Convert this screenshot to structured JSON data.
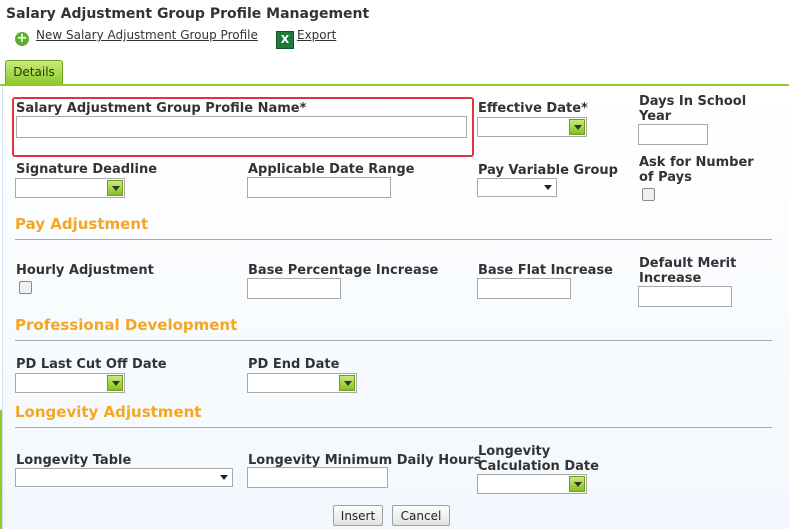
{
  "header": {
    "title": "Salary Adjustment Group Profile Management",
    "new_link": "New Salary Adjustment Group Profile",
    "export_link": "Export"
  },
  "tabs": [
    {
      "label": "Details"
    }
  ],
  "fields": {
    "profile_name": {
      "label": "Salary Adjustment Group Profile Name*",
      "value": ""
    },
    "effective_date": {
      "label": "Effective Date*",
      "value": ""
    },
    "days_in_school_year": {
      "label": "Days In School Year",
      "value": ""
    },
    "signature_deadline": {
      "label": "Signature Deadline",
      "value": ""
    },
    "applicable_date_range": {
      "label": "Applicable Date Range",
      "value": ""
    },
    "pay_variable_group": {
      "label": "Pay Variable Group",
      "value": ""
    },
    "ask_number_of_pays": {
      "label": "Ask for Number of Pays",
      "checked": false
    }
  },
  "pay_adjustment": {
    "title": "Pay Adjustment",
    "hourly_adjustment": {
      "label": "Hourly Adjustment",
      "checked": false
    },
    "base_percentage_increase": {
      "label": "Base Percentage Increase",
      "value": ""
    },
    "base_flat_increase": {
      "label": "Base Flat Increase",
      "value": ""
    },
    "default_merit_increase": {
      "label": "Default Merit Increase",
      "value": ""
    }
  },
  "professional_development": {
    "title": "Professional Development",
    "pd_last_cut_off_date": {
      "label": "PD Last Cut Off Date",
      "value": ""
    },
    "pd_end_date": {
      "label": "PD End Date",
      "value": ""
    }
  },
  "longevity_adjustment": {
    "title": "Longevity Adjustment",
    "longevity_table": {
      "label": "Longevity Table",
      "value": ""
    },
    "longevity_min_daily_hours": {
      "label": "Longevity Minimum Daily Hours",
      "value": ""
    },
    "longevity_calculation_date": {
      "label": "Longevity Calculation Date",
      "value": ""
    }
  },
  "actions": {
    "insert": "Insert",
    "cancel": "Cancel"
  },
  "colors": {
    "accent_green": "#8fca2c",
    "section_orange": "#f5a623",
    "highlight_red": "#e0353e"
  }
}
